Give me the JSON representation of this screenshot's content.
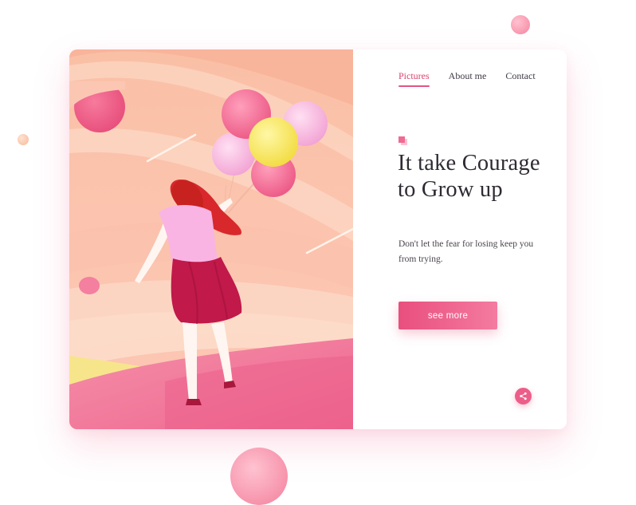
{
  "nav": {
    "items": [
      {
        "label": "Pictures",
        "active": true
      },
      {
        "label": "About me",
        "active": false
      },
      {
        "label": "Contact",
        "active": false
      }
    ]
  },
  "hero": {
    "headline": "It take Courage to Grow up",
    "subtext": "Don't let the fear for losing keep you from trying.",
    "cta_label": "see more"
  },
  "share": {
    "icon": "share-icon"
  },
  "colors": {
    "accent": "#e94f7e",
    "accent_light": "#f47ba0",
    "text_dark": "#2f2a33"
  }
}
